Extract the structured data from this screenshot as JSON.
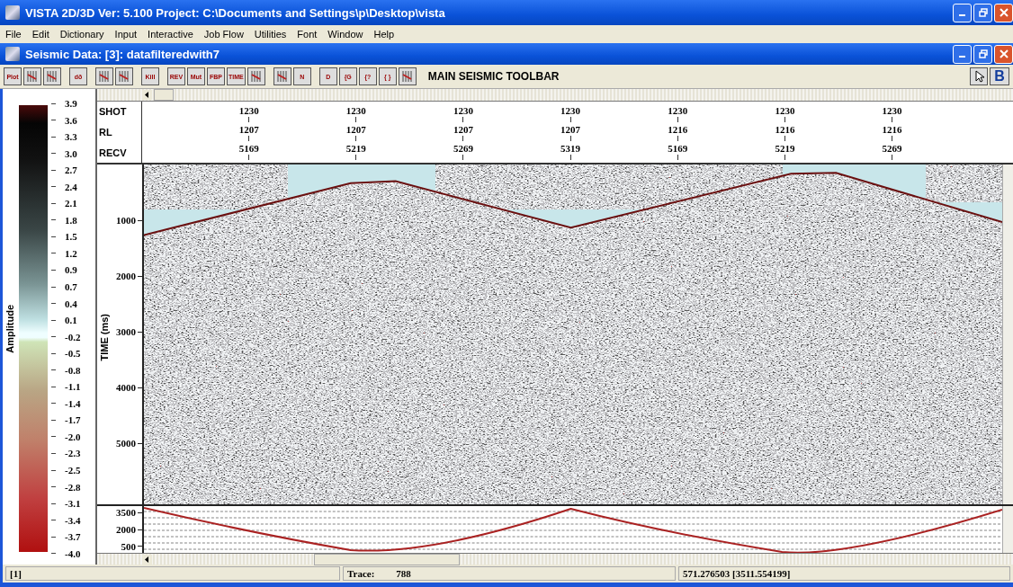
{
  "window": {
    "title": "VISTA 2D/3D Ver: 5.100 Project: C:\\Documents and Settings\\p\\Desktop\\vista"
  },
  "menu": [
    {
      "label": "File"
    },
    {
      "label": "Edit"
    },
    {
      "label": "Dictionary"
    },
    {
      "label": "Input"
    },
    {
      "label": "Interactive"
    },
    {
      "label": "Job Flow"
    },
    {
      "label": "Utilities"
    },
    {
      "label": "Font"
    },
    {
      "label": "Window"
    },
    {
      "label": "Help"
    }
  ],
  "document": {
    "title": "Seismic Data: [3]: datafilteredwith7"
  },
  "toolbar": {
    "title": "MAIN SEISMIC TOOLBAR",
    "buttons": [
      {
        "kind": "text",
        "label": "Plot"
      },
      {
        "kind": "icon"
      },
      {
        "kind": "icon"
      },
      {
        "kind": "text",
        "label": "dð"
      },
      {
        "kind": "icon"
      },
      {
        "kind": "icon"
      },
      {
        "kind": "text",
        "label": "Kill"
      },
      {
        "kind": "text",
        "label": "REV"
      },
      {
        "kind": "text",
        "label": "Mut"
      },
      {
        "kind": "text",
        "label": "FBP"
      },
      {
        "kind": "text",
        "label": "TIME"
      },
      {
        "kind": "icon"
      },
      {
        "kind": "icon"
      },
      {
        "kind": "text",
        "label": "N"
      },
      {
        "kind": "text",
        "label": "D"
      },
      {
        "kind": "text",
        "label": "{G"
      },
      {
        "kind": "text",
        "label": "{?"
      },
      {
        "kind": "text",
        "label": "{ }"
      },
      {
        "kind": "icon"
      }
    ],
    "right_button": "B"
  },
  "colorbar": {
    "label": "Amplitude",
    "ticks": [
      "3.9",
      "3.6",
      "3.3",
      "3.0",
      "2.7",
      "2.4",
      "2.1",
      "1.8",
      "1.5",
      "1.2",
      "0.9",
      "0.7",
      "0.4",
      "0.1",
      "-0.2",
      "-0.5",
      "-0.8",
      "-1.1",
      "-1.4",
      "-1.7",
      "-2.0",
      "-2.3",
      "-2.5",
      "-2.8",
      "-3.1",
      "-3.4",
      "-3.7",
      "-4.0"
    ]
  },
  "header": {
    "labels": [
      "SHOT",
      "RL",
      "RECV"
    ],
    "columns": [
      {
        "shot": "1230",
        "rl": "1207",
        "recv": "5169"
      },
      {
        "shot": "1230",
        "rl": "1207",
        "recv": "5219"
      },
      {
        "shot": "1230",
        "rl": "1207",
        "recv": "5269"
      },
      {
        "shot": "1230",
        "rl": "1207",
        "recv": "5319"
      },
      {
        "shot": "1230",
        "rl": "1216",
        "recv": "5169"
      },
      {
        "shot": "1230",
        "rl": "1216",
        "recv": "5219"
      },
      {
        "shot": "1230",
        "rl": "1216",
        "recv": "5269"
      }
    ]
  },
  "section": {
    "axis_label": "TIME (ms)",
    "ticks": [
      "1000",
      "2000",
      "3000",
      "4000",
      "5000"
    ]
  },
  "lower_panel": {
    "ticks": [
      "3500",
      "2000",
      "500"
    ]
  },
  "status_bar": {
    "panel": "[1]",
    "trace_label": "Trace:",
    "trace": "788",
    "coordinates": "571.276503 [3511.554199]"
  }
}
